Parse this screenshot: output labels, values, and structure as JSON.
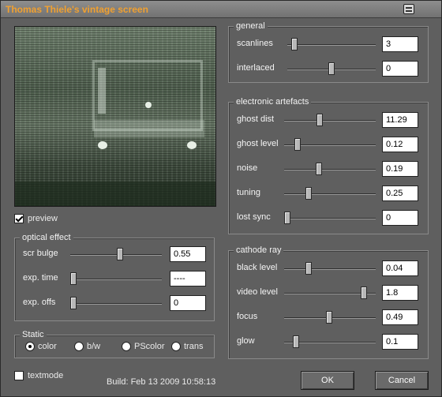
{
  "window": {
    "title": "Thomas Thiele's vintage screen",
    "icon": "window-settings-icon"
  },
  "preview_toggle": {
    "label": "preview",
    "checked": true
  },
  "general": {
    "legend": "general",
    "rows": [
      {
        "label": "scanlines",
        "value": "3",
        "level": 0.05
      },
      {
        "label": "interlaced",
        "value": "0",
        "level": 0.5
      }
    ]
  },
  "electronic": {
    "legend": "electronic artefacts",
    "rows": [
      {
        "label": "ghost dist",
        "value": "11.29",
        "level": 0.38
      },
      {
        "label": "ghost level",
        "value": "0.12",
        "level": 0.12
      },
      {
        "label": "noise",
        "value": "0.19",
        "level": 0.37
      },
      {
        "label": "tuning",
        "value": "0.25",
        "level": 0.25
      },
      {
        "label": "lost sync",
        "value": "0",
        "level": 0.0
      }
    ]
  },
  "optical": {
    "legend": "optical effect",
    "rows": [
      {
        "label": "scr bulge",
        "value": "0.55",
        "level": 0.55
      },
      {
        "label": "exp. time",
        "value": "----",
        "level": 0.0
      },
      {
        "label": "exp. offs",
        "value": "0",
        "level": 0.0
      }
    ]
  },
  "cathode": {
    "legend": "cathode ray",
    "rows": [
      {
        "label": "black level",
        "value": "0.04",
        "level": 0.25
      },
      {
        "label": "video level",
        "value": "1.8",
        "level": 0.9
      },
      {
        "label": "focus",
        "value": "0.49",
        "level": 0.49
      },
      {
        "label": "glow",
        "value": "0.1",
        "level": 0.1
      }
    ]
  },
  "static_group": {
    "legend": "Static",
    "options": [
      {
        "label": "color",
        "checked": true
      },
      {
        "label": "b/w",
        "checked": false
      },
      {
        "label": "PScolor",
        "checked": false
      },
      {
        "label": "trans",
        "checked": false
      }
    ]
  },
  "textmode": {
    "label": "textmode",
    "checked": false
  },
  "build": "Build: Feb 13 2009 10:58:13",
  "buttons": {
    "ok": "OK",
    "cancel": "Cancel"
  }
}
